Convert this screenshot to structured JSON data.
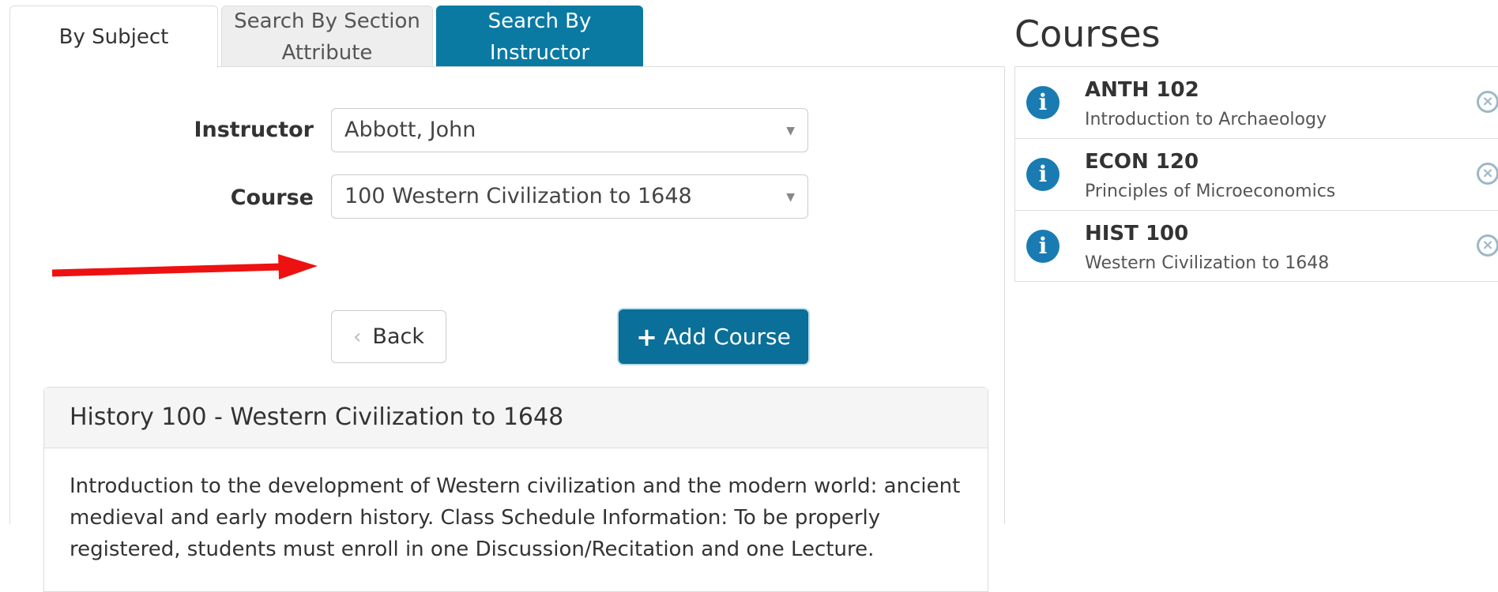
{
  "tabs": [
    {
      "label": "By Subject"
    },
    {
      "label_line1": "Search By Section",
      "label_line2": "Attribute"
    },
    {
      "label_line1": "Search By",
      "label_line2": "Instructor"
    }
  ],
  "form": {
    "instructor_label": "Instructor",
    "instructor_value": "Abbott, John",
    "course_label": "Course",
    "course_value": "100 Western Civilization to 1648",
    "back_label": "Back",
    "add_label": "Add Course"
  },
  "detail": {
    "title": "History 100 - Western Civilization to 1648",
    "body": "Introduction to the development of Western civilization and the modern world: ancient medieval and early modern history. Class Schedule Information:  To be properly registered, students must enroll in one Discussion/Recitation and one Lecture."
  },
  "courses": {
    "title": "Courses",
    "items": [
      {
        "code": "ANTH 102",
        "name": "Introduction to Archaeology"
      },
      {
        "code": "ECON 120",
        "name": "Principles of Microeconomics"
      },
      {
        "code": "HIST 100",
        "name": "Western Civilization to 1648"
      }
    ]
  },
  "colors": {
    "accent": "#0a7aa3",
    "arrow": "#ee1111"
  }
}
